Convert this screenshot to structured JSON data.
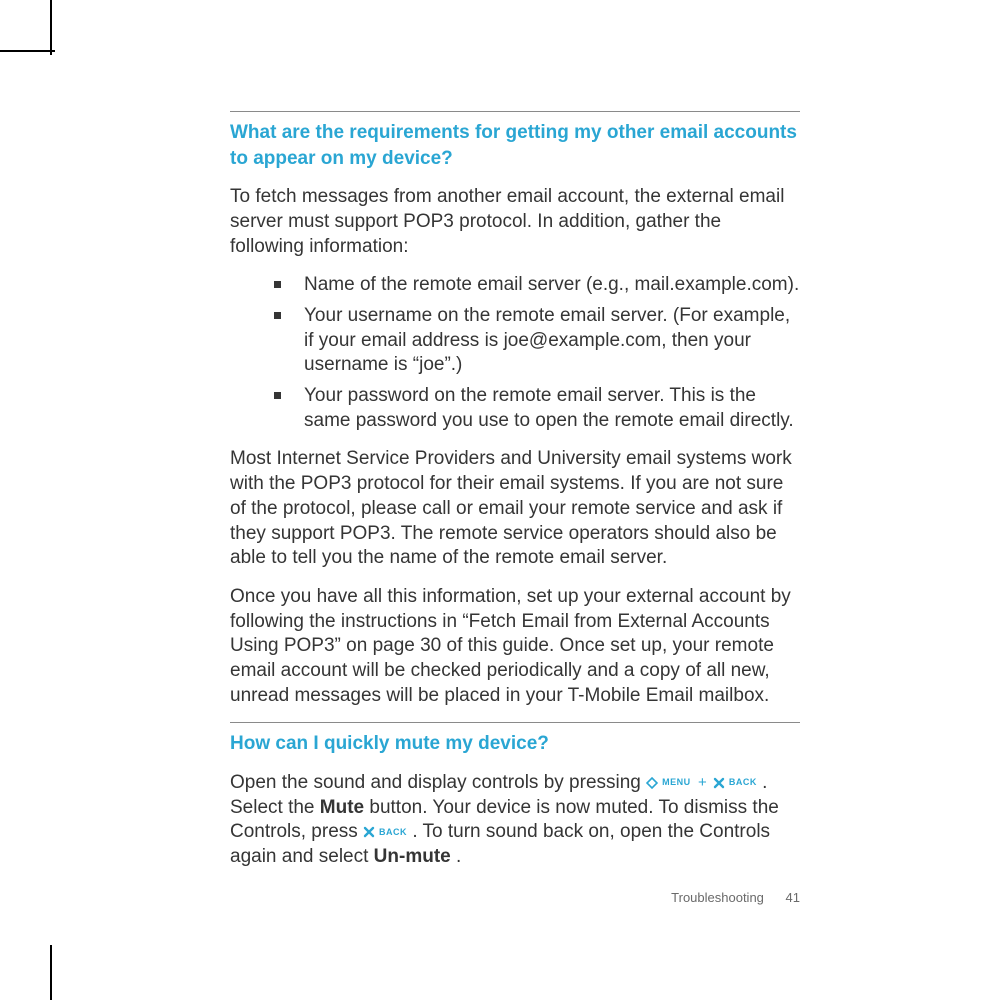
{
  "section1": {
    "heading": "What are the requirements for getting my other email accounts to appear on my device?",
    "intro": "To fetch messages from another email account, the external email server must support POP3 protocol. In addition, gather the following information:",
    "bullets": [
      "Name of the remote email server (e.g., mail.example.com).",
      "Your username on the remote email server. (For example, if your email address is joe@example.com, then your username is “joe”.)",
      "Your password on the remote email server. This is the same password you use to open the remote email directly."
    ],
    "para2": "Most Internet Service Providers and University email systems work with the POP3 protocol for their email systems. If you are not sure of the protocol, please call or email your remote service and ask if they support POP3. The remote service operators should also be able to tell you the name of the remote email server.",
    "para3": "Once you have all this information, set up your external account by following the instructions in “Fetch Email from External Accounts Using POP3” on page 30 of this guide. Once set up, your remote email account will be checked periodically and a copy of all new, unread messages will be placed in your T-Mobile Email mailbox."
  },
  "section2": {
    "heading": "How can I quickly mute my device?",
    "frag1": "Open the sound and display controls by pressing ",
    "menu_label": "MENU",
    "plus": " + ",
    "back_label": "BACK",
    "frag2": ". Select the ",
    "mute": "Mute",
    "frag3": " button. Your device is now muted. To dismiss the Controls, press ",
    "frag4": ". To turn sound back on, open the Controls again and select ",
    "unmute": "Un-mute",
    "frag5": "."
  },
  "footer": {
    "section": "Troubleshooting",
    "page": "41"
  }
}
